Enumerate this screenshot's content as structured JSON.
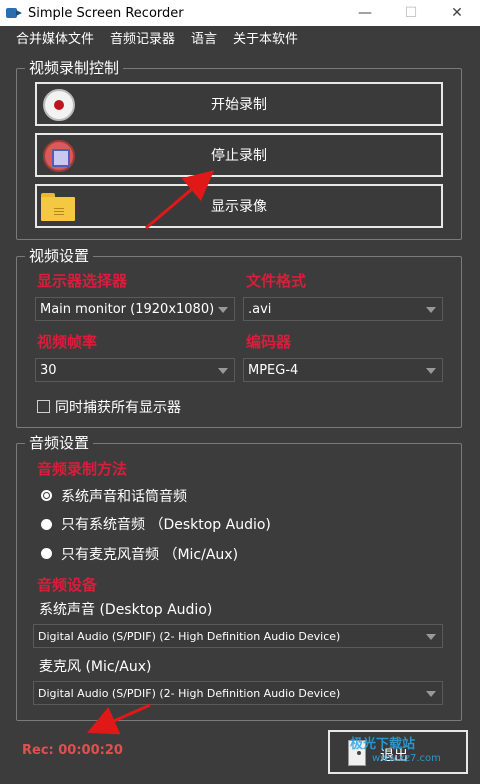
{
  "window": {
    "title": "Simple Screen Recorder",
    "minimize": "—",
    "maximize": "☐",
    "close": "✕"
  },
  "menu": [
    "合并媒体文件",
    "音频记录器",
    "语言",
    "关于本软件"
  ],
  "video_control": {
    "title": "视频录制控制",
    "start_label": "开始录制",
    "stop_label": "停止录制",
    "show_label": "显示录像"
  },
  "video_settings": {
    "title": "视频设置",
    "monitor_label": "显示器选择器",
    "monitor_value": "Main monitor (1920x1080)",
    "format_label": "文件格式",
    "format_value": ".avi",
    "fps_label": "视频帧率",
    "fps_value": "30",
    "codec_label": "编码器",
    "codec_value": "MPEG-4",
    "capture_all_label": "同时捕获所有显示器"
  },
  "audio_settings": {
    "title": "音频设置",
    "method_label": "音频录制方法",
    "options": [
      "系统声音和话筒音频",
      "只有系统音频 （Desktop Audio)",
      "只有麦克风音频 （Mic/Aux)"
    ],
    "device_label": "音频设备",
    "system_sound_label": "系统声音 (Desktop Audio)",
    "system_sound_value": "Digital Audio (S/PDIF) (2- High Definition Audio Device)",
    "mic_label": "麦克风 (Mic/Aux)",
    "mic_value": "Digital Audio (S/PDIF) (2- High Definition Audio Device)"
  },
  "status": {
    "rec_time": "Rec: 00:00:20"
  },
  "exit_label": "退出",
  "watermark": {
    "line1": "极光下载站",
    "line2": "www.xz7.com"
  },
  "colors": {
    "accent_red": "#d81e3a",
    "background": "#3c3c3c",
    "annotation_arrow": "#e01818"
  }
}
